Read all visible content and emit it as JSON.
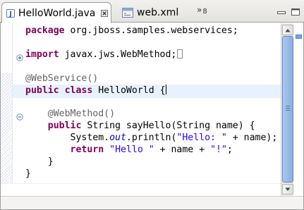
{
  "tabs": [
    {
      "label": "HelloWorld.java",
      "icon": "java-file-icon",
      "active": true
    },
    {
      "label": "web.xml",
      "icon": "xml-file-icon",
      "active": false
    }
  ],
  "overflow": {
    "chevron": "»",
    "count": "8"
  },
  "code_lines": [
    [
      {
        "t": "package",
        "c": "kw"
      },
      {
        "t": " org.jboss.samples.webservices;",
        "c": ""
      }
    ],
    [],
    [
      {
        "t": "import",
        "c": "kw"
      },
      {
        "t": " javax.jws.WebMethod;",
        "c": ""
      }
    ],
    [],
    [
      {
        "t": "@WebService()",
        "c": "ann"
      }
    ],
    [
      {
        "t": "public",
        "c": "kw"
      },
      {
        "t": " ",
        "c": ""
      },
      {
        "t": "class",
        "c": "kw"
      },
      {
        "t": " HelloWorld {",
        "c": ""
      }
    ],
    [],
    [
      {
        "t": "    @WebMethod()",
        "c": "ann"
      }
    ],
    [
      {
        "t": "    ",
        "c": ""
      },
      {
        "t": "public",
        "c": "kw"
      },
      {
        "t": " String sayHello(String name) {",
        "c": ""
      }
    ],
    [
      {
        "t": "        System.",
        "c": ""
      },
      {
        "t": "out",
        "c": "fld"
      },
      {
        "t": ".println(",
        "c": ""
      },
      {
        "t": "\"Hello: \"",
        "c": "str"
      },
      {
        "t": " + name);",
        "c": ""
      }
    ],
    [
      {
        "t": "        ",
        "c": ""
      },
      {
        "t": "return",
        "c": "kw"
      },
      {
        "t": " ",
        "c": ""
      },
      {
        "t": "\"Hello \"",
        "c": "str"
      },
      {
        "t": " + name + ",
        "c": ""
      },
      {
        "t": "\"!\"",
        "c": "str"
      },
      {
        "t": ";",
        "c": ""
      }
    ],
    [
      {
        "t": "    }",
        "c": ""
      }
    ],
    [
      {
        "t": "}",
        "c": ""
      }
    ]
  ],
  "colors": {
    "keyword": "#7f0055",
    "annotation": "#646464",
    "string": "#2a00ff",
    "field": "#0000c0",
    "current_line": "#e8f2fe",
    "scroll_thumb": "#88aee2"
  }
}
